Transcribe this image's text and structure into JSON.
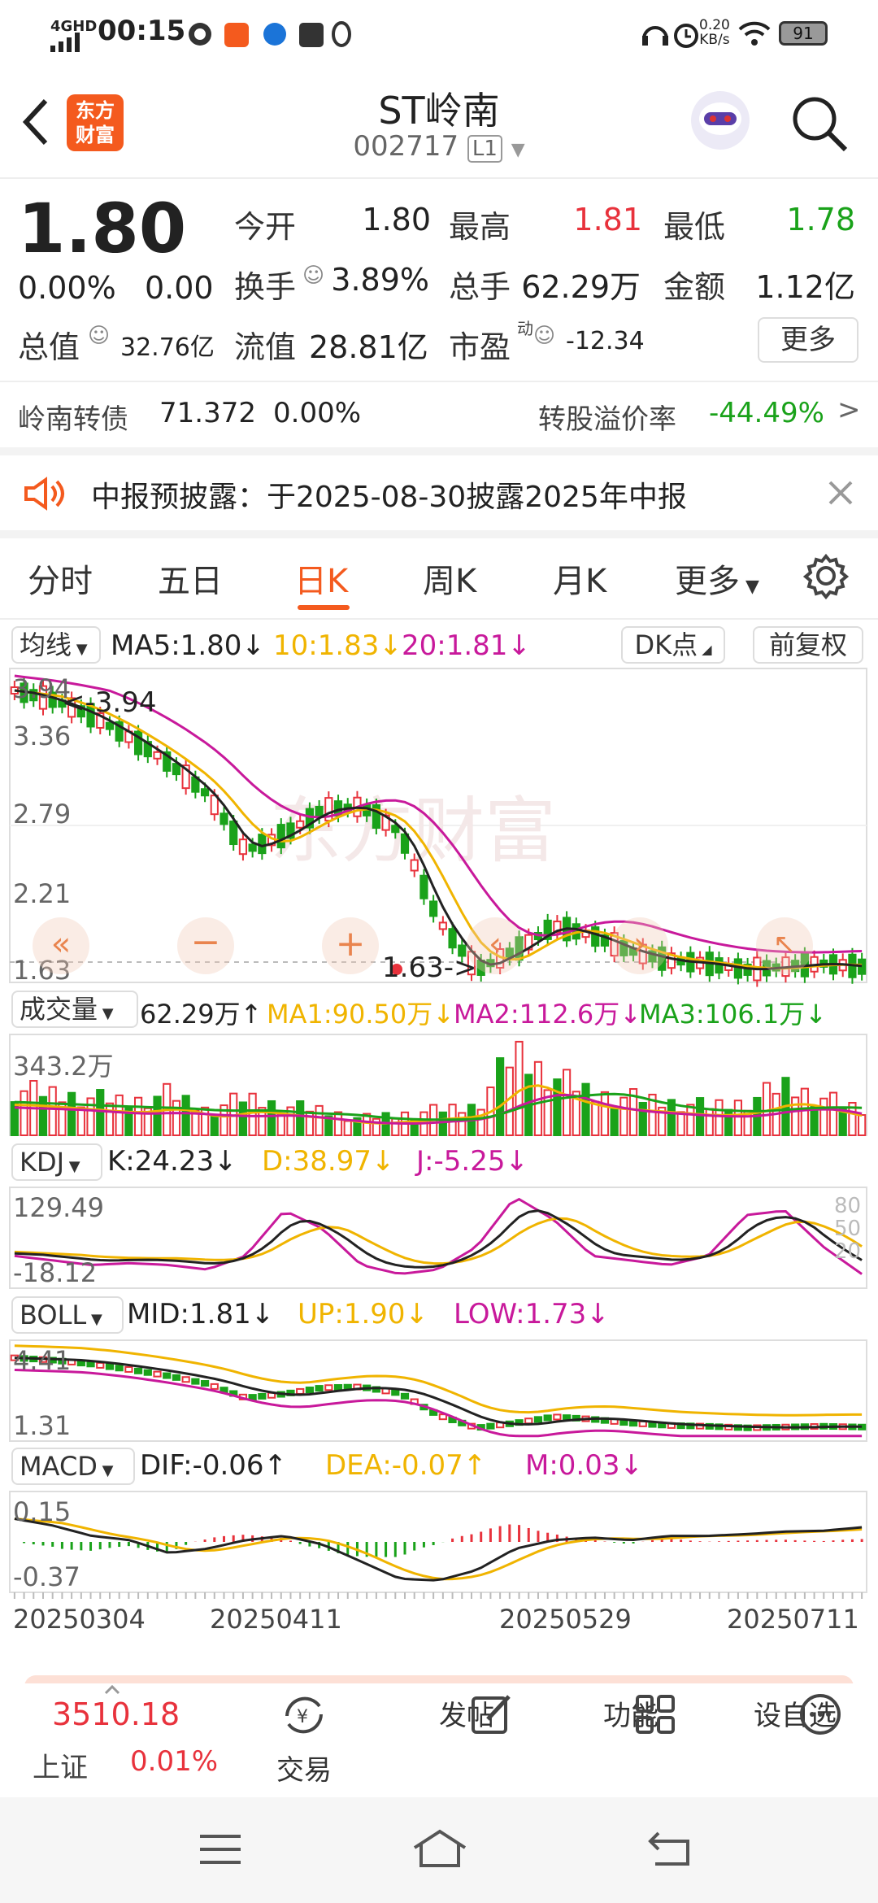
{
  "status": {
    "network": "4GHD",
    "time": "00:15",
    "speed_top": "0.20",
    "speed_bottom": "KB/s",
    "battery": "91"
  },
  "header": {
    "logo_line1": "东方",
    "logo_line2": "财富",
    "title": "ST岭南",
    "code": "002717",
    "level": "L1"
  },
  "quote": {
    "price": "1.80",
    "chg_pct": "0.00%",
    "chg": "0.00",
    "row1": [
      {
        "label": "今开",
        "value": "1.80",
        "color": "#222"
      },
      {
        "label": "最高",
        "value": "1.81",
        "color": "#e8323c"
      },
      {
        "label": "最低",
        "value": "1.78",
        "color": "#1aa21a"
      }
    ],
    "row2": [
      {
        "label": "换手",
        "value": "3.89%"
      },
      {
        "label": "总手",
        "value": "62.29万"
      },
      {
        "label": "金额",
        "value": "1.12亿"
      }
    ],
    "mktcap_label": "总值",
    "mktcap": "32.76亿",
    "float_label": "流值",
    "float": "28.81亿",
    "pe_label": "市盈",
    "pe_sup": "动",
    "pe": "-12.34",
    "more": "更多"
  },
  "bond": {
    "name": "岭南转债",
    "price": "71.372",
    "pct": "0.00%",
    "premium_label": "转股溢价率",
    "premium": "-44.49%"
  },
  "notice": {
    "text": "中报预披露：于2025-08-30披露2025年中报"
  },
  "tabs": [
    "分时",
    "五日",
    "日K",
    "周K",
    "月K",
    "更多"
  ],
  "active_tab": "日K",
  "kline": {
    "ma_label": "均线",
    "ma5": "MA5:1.80↓",
    "ma10": "10:1.83↓",
    "ma20": "20:1.81↓",
    "dk": "DK点",
    "fq": "前复权",
    "ylabels": [
      "3.94",
      "3.36",
      "2.79",
      "2.21",
      "1.63"
    ],
    "high_mark": "3.94",
    "low_mark": "1.63->",
    "colors": {
      "up": "#e8323c",
      "down": "#1aa21a",
      "ma5": "#222222",
      "ma10": "#f0b400",
      "ma20": "#c8199b"
    }
  },
  "volume": {
    "label": "成交量",
    "v": "62.29万↑",
    "ma1": "MA1:90.50万↓",
    "ma2": "MA2:112.6万↓",
    "ma3": "MA3:106.1万↓",
    "ymax": "343.2万"
  },
  "kdj": {
    "label": "KDJ",
    "k": "K:24.23↓",
    "d": "D:38.97↓",
    "j": "J:-5.25↓",
    "ymax": "129.49",
    "ymin": "-18.12",
    "l80": "80",
    "l50": "50",
    "l20": "20"
  },
  "boll": {
    "label": "BOLL",
    "mid": "MID:1.81↓",
    "up": "UP:1.90↓",
    "low": "LOW:1.73↓",
    "ymax": "4.41",
    "ymin": "1.31"
  },
  "macd": {
    "label": "MACD",
    "dif": "DIF:-0.06↑",
    "dea": "DEA:-0.07↑",
    "m": "M:0.03↓",
    "ymax": "0.15",
    "ymin": "-0.37"
  },
  "dates": [
    "20250304",
    "20250411",
    "20250529",
    "20250711"
  ],
  "bottom": {
    "index_value": "3510.18",
    "index_name": "上证",
    "index_pct": "0.01%",
    "nav": [
      "交易",
      "发帖",
      "功能",
      "设自选"
    ]
  }
}
